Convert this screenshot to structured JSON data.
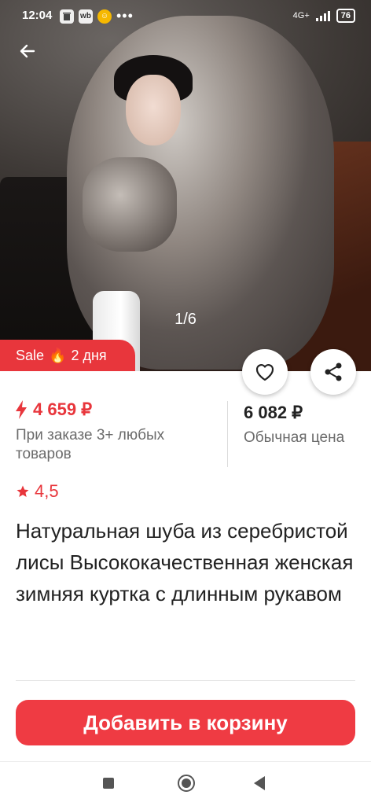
{
  "status_bar": {
    "time": "12:04",
    "left_icons": [
      "trash-icon",
      "wb-icon",
      "app-icon"
    ],
    "overflow": "•••",
    "network": "4G+",
    "battery": "76"
  },
  "gallery": {
    "counter": "1/6"
  },
  "sale_badge": {
    "label": "Sale",
    "fire_icon": "🔥",
    "duration": "2 дня"
  },
  "price": {
    "promo_price": "4 659 ₽",
    "promo_note": "При заказе 3+ любых товаров",
    "regular_price": "6 082 ₽",
    "regular_label": "Обычная цена"
  },
  "rating": {
    "value": "4,5"
  },
  "product": {
    "title": "Натуральная шуба из серебристой лисы Высококачественная женская зимняя куртка с длинным рукавом"
  },
  "actions": {
    "add_to_cart": "Добавить в корзину"
  },
  "colors": {
    "accent": "#e8363c",
    "button": "#ef3b43"
  }
}
